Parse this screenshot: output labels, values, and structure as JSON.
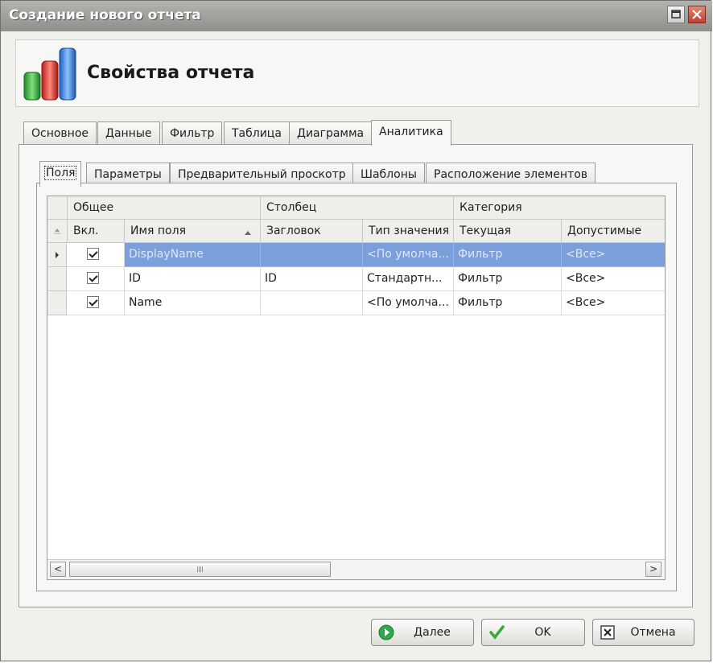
{
  "window": {
    "title": "Создание нового отчета"
  },
  "header": {
    "title": "Свойства отчета"
  },
  "main_tabs": [
    "Основное",
    "Данные",
    "Фильтр",
    "Таблица",
    "Диаграмма",
    "Аналитика"
  ],
  "active_main_tab": "Аналитика",
  "sub_tabs": [
    "Поля",
    "Параметры",
    "Предварительный проскотр",
    "Шаблоны",
    "Расположение элементов"
  ],
  "active_sub_tab": "Поля",
  "grid": {
    "bands": [
      "Общее",
      "Столбец",
      "Категория"
    ],
    "columns": [
      "Вкл.",
      "Имя поля",
      "Загловок",
      "Тип значения",
      "Текущая",
      "Допустимые"
    ],
    "rows": [
      {
        "enabled": true,
        "field": "DisplayName",
        "caption": "",
        "type": "<По умолча...",
        "current": "Фильтр",
        "allowed": "<Все>",
        "selected": true
      },
      {
        "enabled": true,
        "field": "ID",
        "caption": "ID",
        "type": "Стандартн...",
        "current": "Фильтр",
        "allowed": "<Все>",
        "selected": false
      },
      {
        "enabled": true,
        "field": "Name",
        "caption": "",
        "type": "<По умолча...",
        "current": "Фильтр",
        "allowed": "<Все>",
        "selected": false
      }
    ]
  },
  "buttons": {
    "next": "Далее",
    "ok": "OK",
    "cancel": "Отмена"
  },
  "colors": {
    "selection": "#7b9fdb",
    "next_icon": "#2fa84a",
    "ok_icon": "#3aa83a"
  }
}
